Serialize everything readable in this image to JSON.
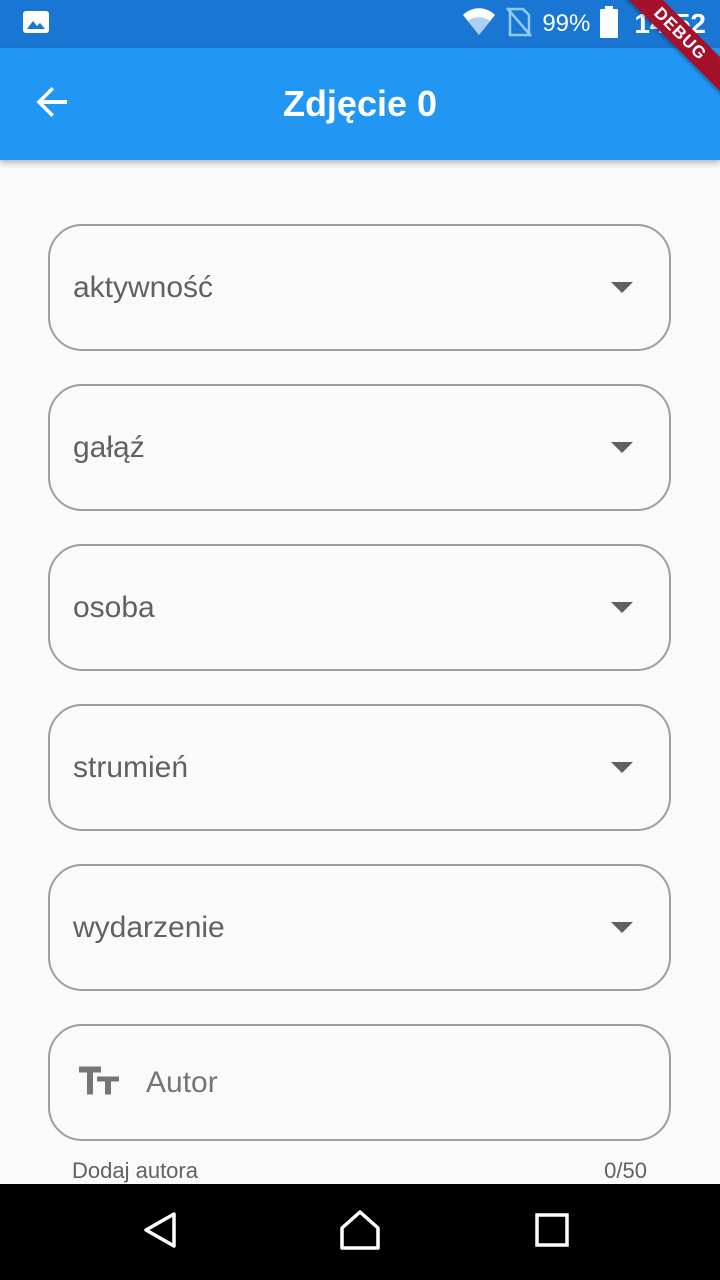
{
  "status_bar": {
    "battery_percent": "99%",
    "time": "14:52",
    "icons": [
      "image-notification-icon",
      "wifi-icon",
      "no-sim-icon",
      "battery-icon"
    ]
  },
  "app_bar": {
    "title": "Zdjęcie 0",
    "back_icon": "arrow-back-icon",
    "background": "#2196f3"
  },
  "debug_banner": "DEBUG",
  "form": {
    "dropdowns": [
      {
        "label": "aktywność"
      },
      {
        "label": "gałąź"
      },
      {
        "label": "osoba"
      },
      {
        "label": "strumień"
      },
      {
        "label": "wydarzenie"
      }
    ],
    "author": {
      "placeholder": "Autor",
      "value": "",
      "icon": "text-fields-icon",
      "helper_text": "Dodaj autora",
      "counter": "0/50"
    }
  },
  "nav_bar": {
    "buttons": [
      "back-triangle-icon",
      "home-icon",
      "recents-icon"
    ]
  }
}
